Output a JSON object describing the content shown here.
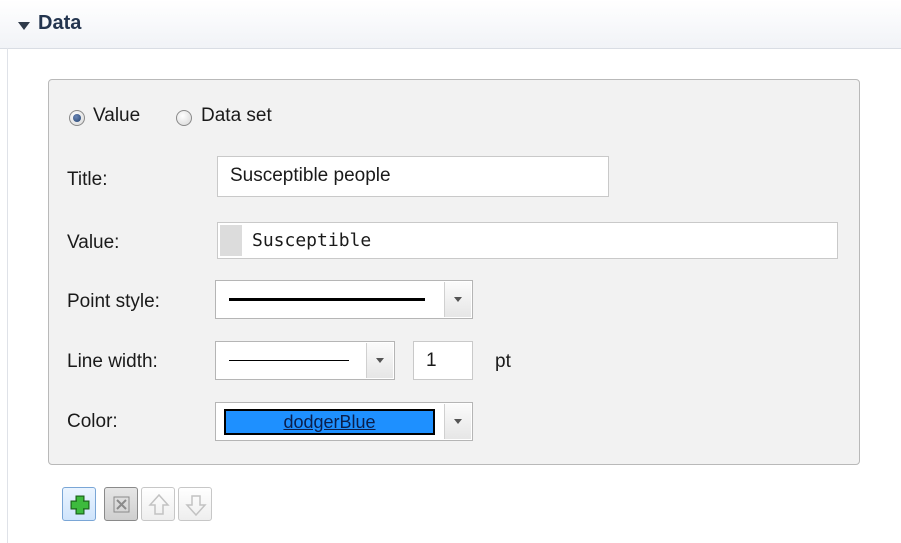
{
  "section": {
    "title": "Data",
    "toggle_icon": "triangle-down-icon"
  },
  "source_mode": {
    "options": [
      {
        "label": "Value",
        "selected": true
      },
      {
        "label": "Data set",
        "selected": false
      }
    ]
  },
  "form": {
    "title_label": "Title:",
    "title_value": "Susceptible people",
    "value_label": "Value:",
    "value_value": "Susceptible",
    "point_style_label": "Point style:",
    "point_style_value": "solid-line",
    "line_width_label": "Line width:",
    "line_width_style": "thin-line",
    "line_width_value": "1",
    "line_width_unit": "pt",
    "color_label": "Color:",
    "color_value": "dodgerBlue",
    "color_hex": "#1e90ff"
  },
  "toolbar": {
    "buttons": [
      {
        "name": "add",
        "icon": "plus-icon",
        "enabled": true
      },
      {
        "name": "remove",
        "icon": "close-icon",
        "enabled": true
      },
      {
        "name": "move-up",
        "icon": "arrow-up-icon",
        "enabled": false
      },
      {
        "name": "move-down",
        "icon": "arrow-down-icon",
        "enabled": false
      }
    ]
  }
}
